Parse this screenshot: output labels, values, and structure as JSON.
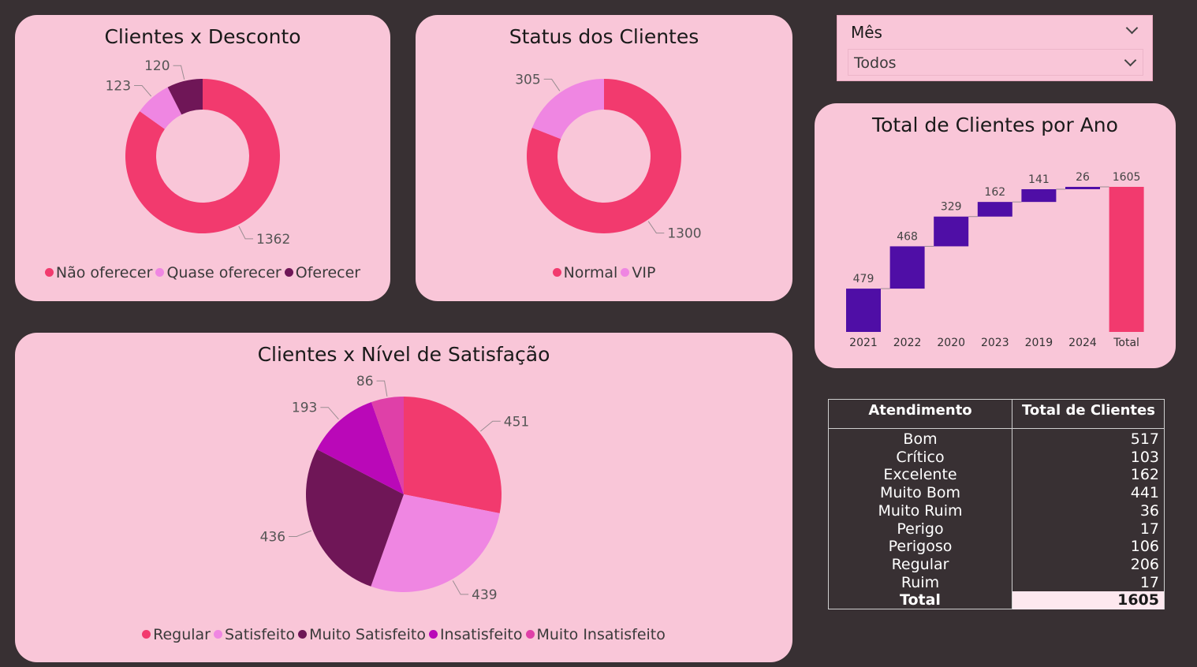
{
  "colors": {
    "background": "#383033",
    "card": "#f9c6d8",
    "pink": "#f23a6e",
    "light_pink": "#ef86e2",
    "dark_purple": "#6f1657",
    "magenta": "#ba08b8",
    "orchid": "#df40a8",
    "indigo": "#4f0ea6"
  },
  "filter": {
    "label": "Mês",
    "value": "Todos",
    "icon": "chevron-down-icon"
  },
  "chart_data": [
    {
      "id": "desconto",
      "type": "donut",
      "title": "Clientes x Desconto",
      "categories": [
        "Não oferecer",
        "Quase oferecer",
        "Oferecer"
      ],
      "values": [
        1362,
        123,
        120
      ],
      "colors": [
        "#f23a6e",
        "#ef86e2",
        "#6f1657"
      ]
    },
    {
      "id": "status",
      "type": "donut",
      "title": "Status dos Clientes",
      "categories": [
        "Normal",
        "VIP"
      ],
      "values": [
        1300,
        305
      ],
      "colors": [
        "#f23a6e",
        "#ef86e2"
      ]
    },
    {
      "id": "satisfacao",
      "type": "pie",
      "title": "Clientes x Nível de Satisfação",
      "categories": [
        "Regular",
        "Satisfeito",
        "Muito Satisfeito",
        "Insatisfeito",
        "Muito Insatisfeito"
      ],
      "values": [
        451,
        439,
        436,
        193,
        86
      ],
      "colors": [
        "#f23a6e",
        "#ef86e2",
        "#6f1657",
        "#ba08b8",
        "#df40a8"
      ]
    },
    {
      "id": "ano",
      "type": "waterfall",
      "title": "Total de Clientes por Ano",
      "categories": [
        "2021",
        "2022",
        "2020",
        "2023",
        "2019",
        "2024"
      ],
      "values": [
        479,
        468,
        329,
        162,
        141,
        26
      ],
      "total_label": "Total",
      "total": 1605,
      "step_color": "#4f0ea6",
      "total_color": "#f23a6e"
    }
  ],
  "table": {
    "headers": [
      "Atendimento",
      "Total de Clientes"
    ],
    "rows": [
      [
        "Bom",
        "517"
      ],
      [
        "Crítico",
        "103"
      ],
      [
        "Excelente",
        "162"
      ],
      [
        "Muito Bom",
        "441"
      ],
      [
        "Muito Ruim",
        "36"
      ],
      [
        "Perigo",
        "17"
      ],
      [
        "Perigoso",
        "106"
      ],
      [
        "Regular",
        "206"
      ],
      [
        "Ruim",
        "17"
      ]
    ],
    "total": [
      "Total",
      "1605"
    ]
  }
}
